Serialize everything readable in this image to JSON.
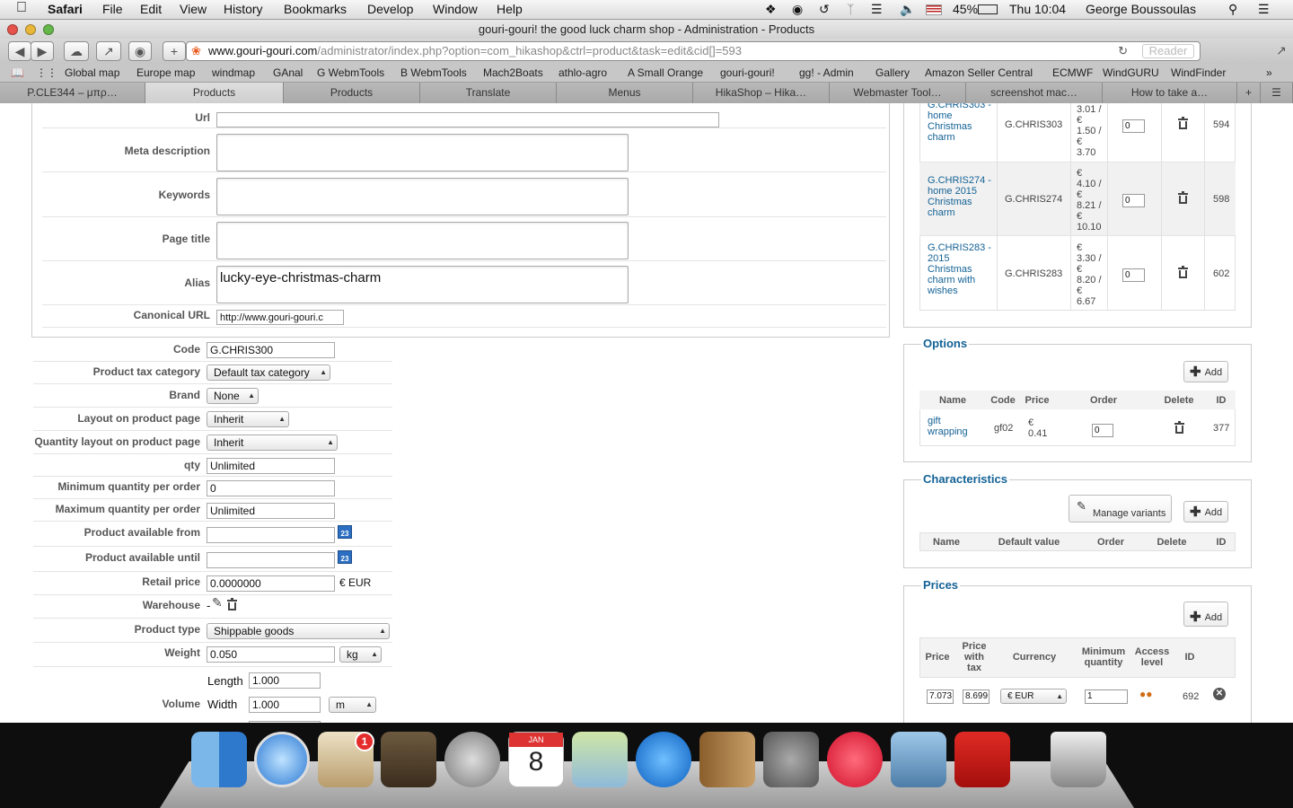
{
  "menubar": {
    "app": "Safari",
    "items": [
      "File",
      "Edit",
      "View",
      "History",
      "Bookmarks",
      "Develop",
      "Window",
      "Help"
    ],
    "battery": "45%",
    "clock": "Thu 10:04",
    "user": "George Boussoulas"
  },
  "window": {
    "title": "gouri-gouri! the good luck charm shop - Administration - Products"
  },
  "toolbar": {
    "url_domain": "www.gouri-gouri.com",
    "url_path": "/administrator/index.php?option=com_hikashop&ctrl=product&task=edit&cid[]=593",
    "reader_label": "Reader"
  },
  "bookmarks": [
    "Global map",
    "Europe map",
    "windmap",
    "GAnal",
    "G WebmTools",
    "B WebmTools",
    "Mach2Boats",
    "athlo-agro",
    "A Small Orange",
    "gouri-gouri!",
    "gg! - Admin",
    "Gallery",
    "Amazon Seller Central",
    "ECMWF",
    "WindGURU",
    "WindFinder"
  ],
  "tabs": [
    "P.CLE344 – μπρ…",
    "Products",
    "Products",
    "Translate",
    "Menus",
    "HikaShop – Hika…",
    "Webmaster Tool…",
    "screenshot mac…",
    "How to take a…"
  ],
  "seo": {
    "url_label": "Url",
    "meta_label": "Meta description",
    "keywords_label": "Keywords",
    "pagetitle_label": "Page title",
    "alias_label": "Alias",
    "alias_value": "lucky-eye-christmas-charm",
    "canonical_label": "Canonical URL",
    "canonical_value": "http://www.gouri-gouri.c"
  },
  "form": {
    "code_label": "Code",
    "code_value": "G.CHRIS300",
    "tax_label": "Product tax category",
    "tax_value": "Default tax category",
    "brand_label": "Brand",
    "brand_value": "None",
    "layout_label": "Layout on product page",
    "layout_value": "Inherit",
    "qlayout_label": "Quantity layout on product page",
    "qlayout_value": "Inherit",
    "qty_label": "qty",
    "qty_value": "Unlimited",
    "minq_label": "Minimum quantity per order",
    "minq_value": "0",
    "maxq_label": "Maximum quantity per order",
    "maxq_value": "Unlimited",
    "from_label": "Product available from",
    "until_label": "Product available until",
    "cal_day": "23",
    "retail_label": "Retail price",
    "retail_value": "0.0000000",
    "retail_unit": "€ EUR",
    "warehouse_label": "Warehouse",
    "warehouse_value": "-",
    "type_label": "Product type",
    "type_value": "Shippable goods",
    "weight_label": "Weight",
    "weight_value": "0.050",
    "weight_unit": "kg",
    "volume_label": "Volume",
    "length_label": "Length",
    "length_value": "1.000",
    "width_label": "Width",
    "width_value": "1.000",
    "width_unit": "m"
  },
  "related": [
    {
      "name": "G.CHRIS303 - home Christmas charm",
      "code": "G.CHRIS303",
      "price": "3.01 / € 1.50 / € 3.70",
      "order": "0",
      "id": "594"
    },
    {
      "name": "G.CHRIS274 - home 2015 Christmas charm",
      "code": "G.CHRIS274",
      "price": "€ 4.10 / € 8.21 / € 10.10",
      "order": "0",
      "id": "598"
    },
    {
      "name": "G.CHRIS283 - 2015 Christmas charm with wishes",
      "code": "G.CHRIS283",
      "price": "€ 3.30 / € 8.20 / € 6.67",
      "order": "0",
      "id": "602"
    }
  ],
  "options": {
    "title": "Options",
    "add_label": "Add",
    "headers": [
      "Name",
      "Code",
      "Price",
      "Order",
      "Delete",
      "ID"
    ],
    "row": {
      "name": "gift wrapping",
      "code": "gf02",
      "price": "€ 0.41",
      "order": "0",
      "id": "377"
    }
  },
  "characteristics": {
    "title": "Characteristics",
    "manage_label": "Manage variants",
    "add_label": "Add",
    "headers": [
      "Name",
      "Default value",
      "Order",
      "Delete",
      "ID"
    ]
  },
  "prices": {
    "title": "Prices",
    "add_label": "Add",
    "headers": [
      "Price",
      "Price with tax",
      "Currency",
      "Minimum quantity",
      "Access level",
      "ID"
    ],
    "row": {
      "price": "7.073",
      "price_tax": "8.699",
      "currency": "€ EUR",
      "min_qty": "1",
      "id": "692"
    }
  },
  "dock": {
    "calendar_month": "JAN",
    "calendar_day": "8",
    "mail_badge": "1"
  }
}
